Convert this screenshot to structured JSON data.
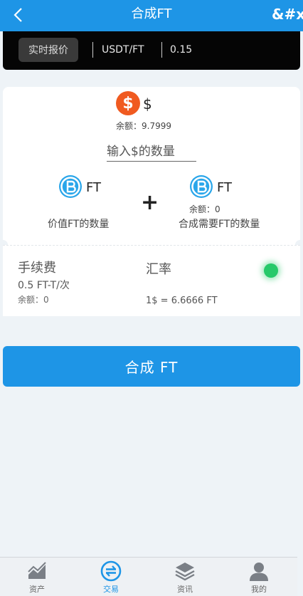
{
  "header": {
    "title": "合成FT",
    "right_text": "&#x"
  },
  "quote_bar": {
    "button_label": "实时报价",
    "pair": "USDT/FT",
    "price": "0.15"
  },
  "dollar_section": {
    "currency_label": "$",
    "balance": "余额：9.7999",
    "input_placeholder": "输入$的数量"
  },
  "ft_left": {
    "label": "FT",
    "caption": "价值FT的数量"
  },
  "plus_sign": "+",
  "ft_right": {
    "label": "FT",
    "balance": "余额：0",
    "caption": "合成需要FT的数量"
  },
  "fee": {
    "title": "手续费",
    "value": "0.5 FT-T/次",
    "balance": "余额：0"
  },
  "rate": {
    "title": "汇率",
    "value": "1$ = 6.6666 FT"
  },
  "status_color": "#27c96a",
  "compose_button": "合成 FT",
  "tabbar": {
    "items": [
      {
        "label": "资产",
        "icon": "chart-icon"
      },
      {
        "label": "交易",
        "icon": "exchange-icon"
      },
      {
        "label": "资讯",
        "icon": "layers-icon"
      },
      {
        "label": "我的",
        "icon": "user-icon"
      }
    ],
    "active": "交易"
  },
  "colors": {
    "primary": "#1e95e6",
    "quote_bar": "#050505",
    "coin": "#f05a20"
  }
}
